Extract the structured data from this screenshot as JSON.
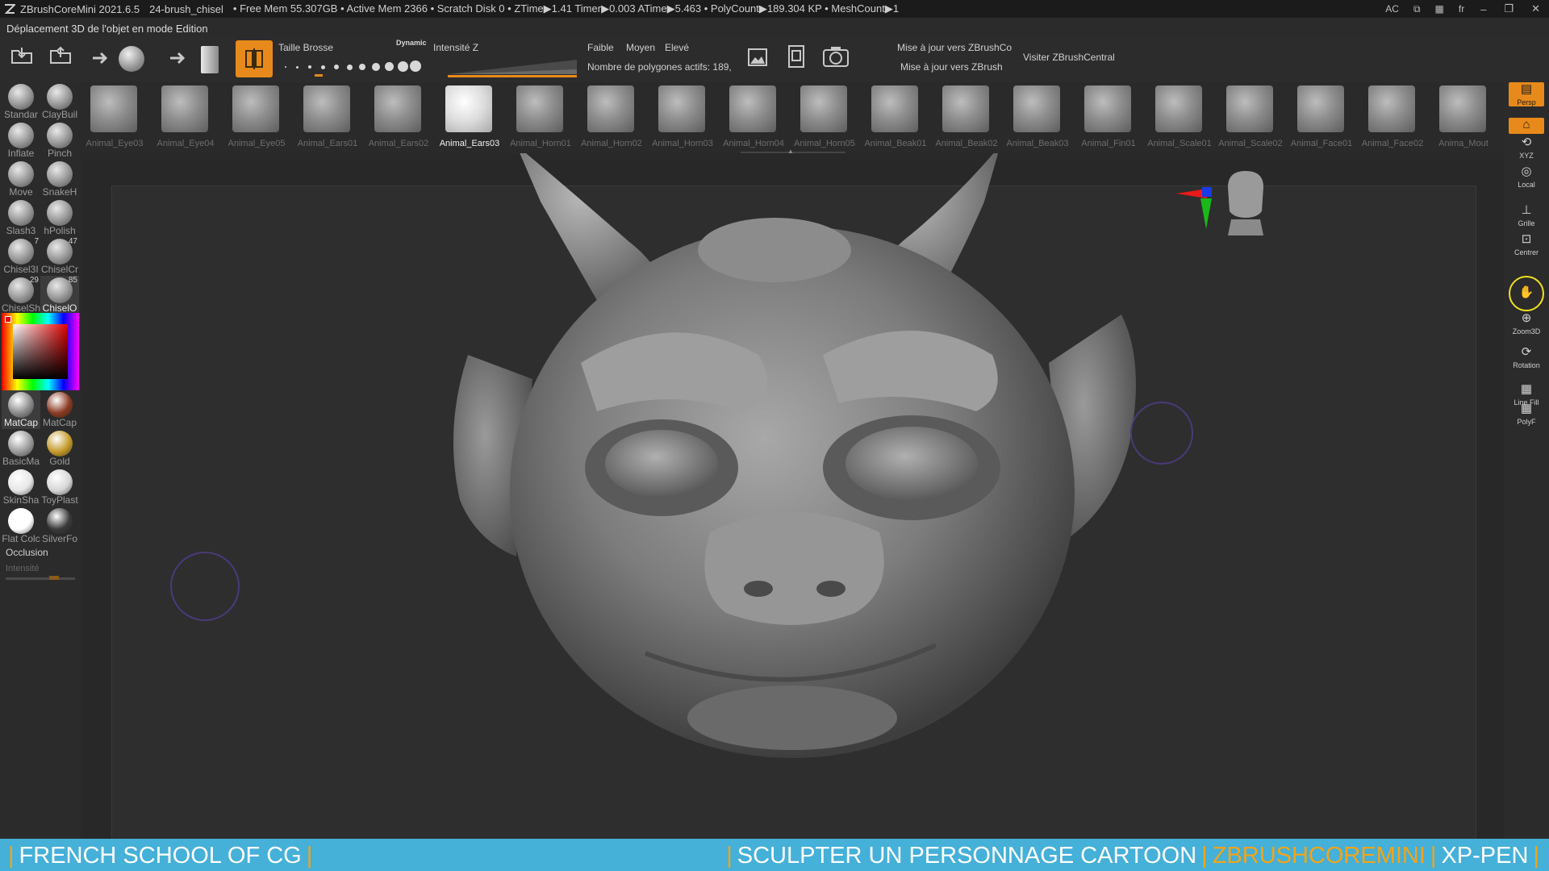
{
  "titlebar": {
    "app_title": "ZBrushCoreMini 2021.6.5",
    "document_name": "24-brush_chisel",
    "stats": "• Free Mem 55.307GB • Active Mem 2366 • Scratch Disk 0 • ZTime▶1.41 Timer▶0.003 ATime▶5.463 • PolyCount▶189.304 KP • MeshCount▶1",
    "ac_label": "AC",
    "lang": "fr",
    "minimize": "‒",
    "restore": "❐",
    "close": "✕"
  },
  "status": {
    "text": "Déplacement 3D de l'objet en mode Edition"
  },
  "toolbar": {
    "brush_size_label": "Taille Brosse",
    "dynamic_label": "Dynamic",
    "z_intensity_label": "Intensité Z",
    "faible": "Faible",
    "moyen": "Moyen",
    "eleve": "Elevé",
    "active_polys": "Nombre de polygones actifs: 189,",
    "update_zbrushco": "Mise à jour vers ZBrushCo",
    "update_zbrush": "Mise à jour vers ZBrush",
    "visit_central": "Visiter ZBrushCentral",
    "brush_size_value": 0.25,
    "z_intensity_value": 1.0
  },
  "brushstrip": {
    "items": [
      {
        "label": "Animal_Eye03"
      },
      {
        "label": "Animal_Eye04"
      },
      {
        "label": "Animal_Eye05"
      },
      {
        "label": "Animal_Ears01"
      },
      {
        "label": "Animal_Ears02"
      },
      {
        "label": "Animal_Ears03",
        "selected": true
      },
      {
        "label": "Animal_Horn01"
      },
      {
        "label": "Animal_Horn02"
      },
      {
        "label": "Animal_Horn03"
      },
      {
        "label": "Animal_Horn04"
      },
      {
        "label": "Animal_Horn05"
      },
      {
        "label": "Animal_Beak01"
      },
      {
        "label": "Animal_Beak02"
      },
      {
        "label": "Animal_Beak03"
      },
      {
        "label": "Animal_Fin01"
      },
      {
        "label": "Animal_Scale01"
      },
      {
        "label": "Animal_Scale02"
      },
      {
        "label": "Animal_Face01"
      },
      {
        "label": "Animal_Face02"
      },
      {
        "label": "Anima_Mout"
      }
    ]
  },
  "leftpanel": {
    "brushes": [
      {
        "label": "Standar"
      },
      {
        "label": "ClayBuil"
      },
      {
        "label": "Inflate"
      },
      {
        "label": "Pinch"
      },
      {
        "label": "Move"
      },
      {
        "label": "SnakeH"
      },
      {
        "label": "Slash3"
      },
      {
        "label": "hPolish"
      },
      {
        "label": "Chisel3I",
        "num": "7"
      },
      {
        "label": "ChiselCr",
        "num": "47"
      },
      {
        "label": "ChiselSh",
        "num": "29"
      },
      {
        "label": "ChiselO",
        "num": "85",
        "active": true
      }
    ],
    "materials": [
      {
        "label": "MatCap",
        "color": "#8a8a8a",
        "active": true
      },
      {
        "label": "MatCap",
        "color": "#8a3a22"
      },
      {
        "label": "BasicMa",
        "color": "#9a9a9a"
      },
      {
        "label": "Gold",
        "color": "#c59a2a"
      },
      {
        "label": "SkinSha",
        "color": "#e6e6e6"
      },
      {
        "label": "ToyPlast",
        "color": "#d6d6d6"
      },
      {
        "label": "Flat Colc",
        "color": "#ffffff"
      },
      {
        "label": "SilverFo",
        "color": "#3a3a3a"
      }
    ],
    "occlusion_label": "Occlusion",
    "intensity_label": "Intensité"
  },
  "rightpanel": {
    "buttons": [
      {
        "label": "Persp",
        "icon": "persp-icon"
      },
      {
        "label": "",
        "icon": "floor-icon"
      },
      {
        "label": "XYZ",
        "icon": "xyz-icon"
      },
      {
        "label": "Local",
        "icon": "local-icon"
      },
      {
        "label": "Grille",
        "icon": "grid-icon"
      },
      {
        "label": "Centrer",
        "icon": "center-icon"
      },
      {
        "label": "",
        "icon": "move-icon"
      },
      {
        "label": "Zoom3D",
        "icon": "zoom-icon"
      },
      {
        "label": "Rotation",
        "icon": "rotation-icon"
      },
      {
        "label": "Line Fill",
        "icon": "linefill-icon"
      },
      {
        "label": "PolyF",
        "icon": "polyf-icon"
      }
    ]
  },
  "banner": {
    "left": "FRENCH SCHOOL OF CG",
    "right_1": "SCULPTER UN PERSONNAGE CARTOON",
    "right_2": "ZBRUSHCOREMINI",
    "right_3": "XP-PEN",
    "bar": "|"
  },
  "colors": {
    "accent": "#e88a1b",
    "banner": "#45b0d8",
    "highlight": "#f2a418"
  }
}
